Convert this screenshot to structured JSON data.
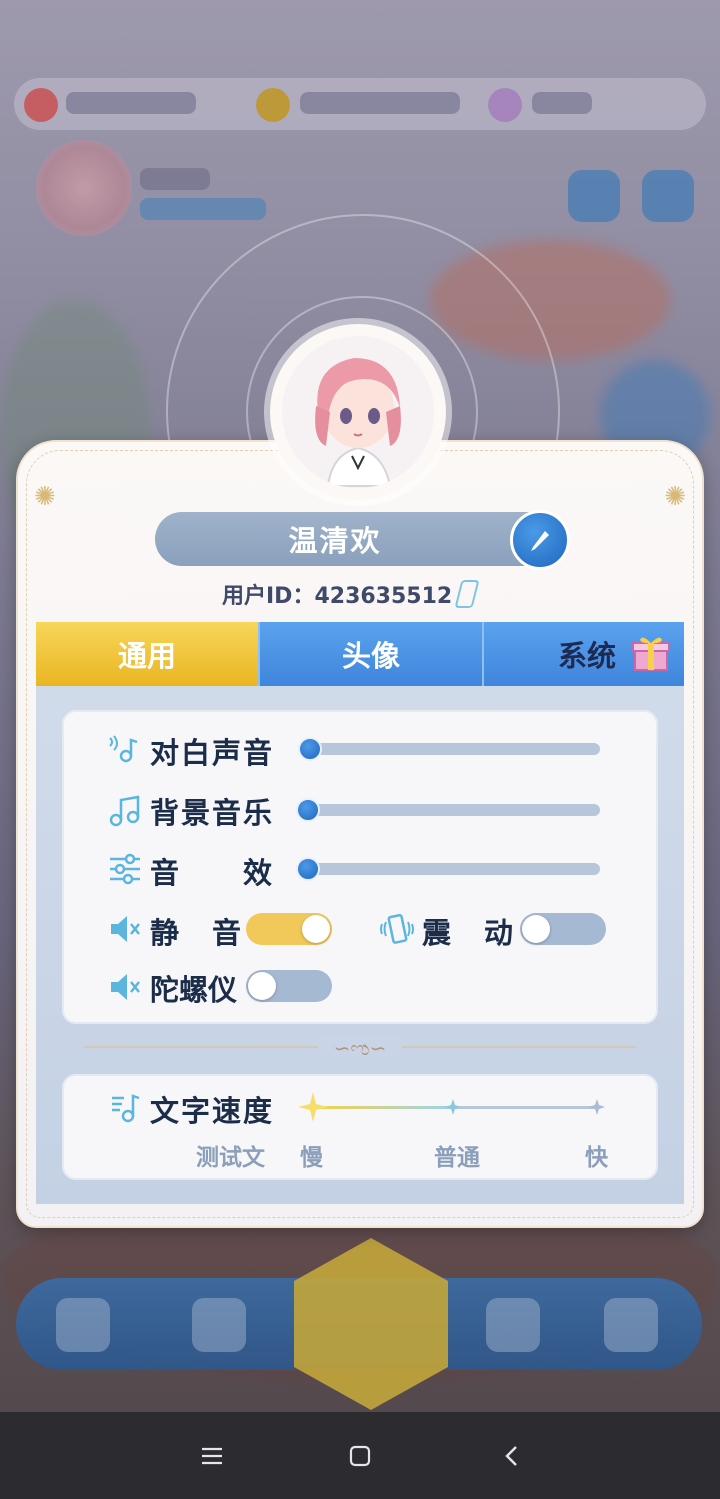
{
  "profile": {
    "name": "温清欢",
    "user_id_label": "用户ID：",
    "user_id": "423635512"
  },
  "tabs": [
    {
      "label": "通用",
      "active": true
    },
    {
      "label": "头像",
      "active": false
    },
    {
      "label": "系统",
      "active": false
    }
  ],
  "settings": {
    "dialogue_volume": {
      "label": "对白声音",
      "value": 0.0
    },
    "bgm_volume": {
      "label": "背景音乐",
      "value": 0.0
    },
    "sfx_volume": {
      "label": "音　　效",
      "value": 0.0
    },
    "mute": {
      "label": "静　音",
      "on": true
    },
    "vibration": {
      "label": "震　动",
      "on": false
    },
    "gyroscope": {
      "label": "陀螺仪",
      "on": false
    }
  },
  "text_speed": {
    "label": "文字速度",
    "preview": "测试文",
    "options": [
      "慢",
      "普通",
      "快"
    ],
    "selected": "慢"
  },
  "colors": {
    "accent_blue": "#3f85dc",
    "accent_yellow": "#eab523",
    "text_dark": "#1c2d4a"
  }
}
